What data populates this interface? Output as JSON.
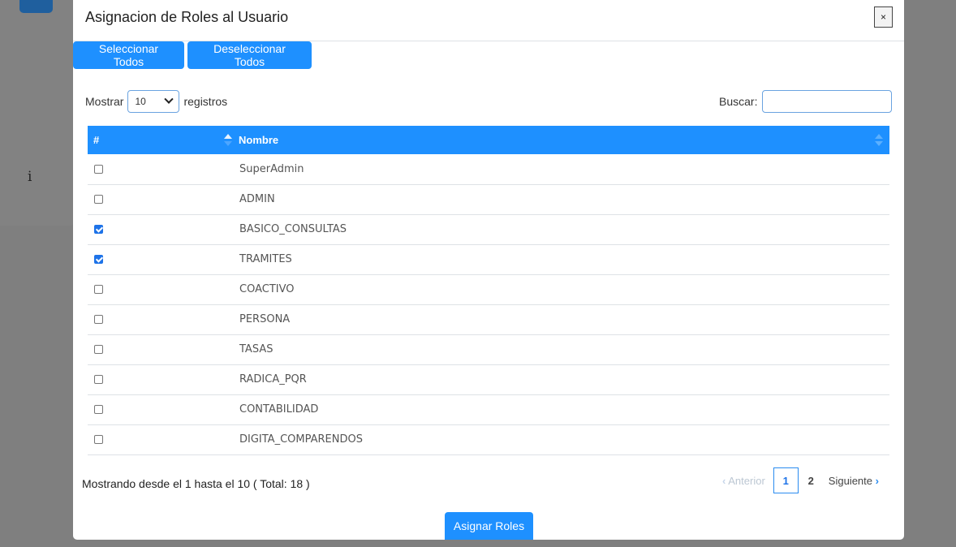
{
  "background": {
    "info_glyph": "i"
  },
  "modal": {
    "title": "Asignacion de Roles al Usuario",
    "close_label": "×",
    "select_all_label": "Seleccionar Todos",
    "deselect_all_label": "Deseleccionar Todos",
    "length_prefix": "Mostrar",
    "length_value": "10",
    "length_suffix": "registros",
    "search_label": "Buscar:",
    "search_value": "",
    "table": {
      "headers": [
        "#",
        "Nombre"
      ],
      "rows": [
        {
          "checked": false,
          "name": "SuperAdmin"
        },
        {
          "checked": false,
          "name": "ADMIN"
        },
        {
          "checked": true,
          "name": "BASICO_CONSULTAS"
        },
        {
          "checked": true,
          "name": "TRAMITES"
        },
        {
          "checked": false,
          "name": "COACTIVO"
        },
        {
          "checked": false,
          "name": "PERSONA"
        },
        {
          "checked": false,
          "name": "TASAS"
        },
        {
          "checked": false,
          "name": "RADICA_PQR"
        },
        {
          "checked": false,
          "name": "CONTABILIDAD"
        },
        {
          "checked": false,
          "name": "DIGITA_COMPARENDOS"
        }
      ]
    },
    "info_text": "Mostrando desde el 1 hasta el 10 ( Total: 18 )",
    "pagination": {
      "prev_label": "Anterior",
      "pages": [
        "1",
        "2"
      ],
      "current_page": "1",
      "next_label": "Siguiente"
    },
    "assign_label": "Asignar Roles"
  },
  "colors": {
    "primary": "#1e90ff",
    "backdrop": "#7f7f7f"
  }
}
